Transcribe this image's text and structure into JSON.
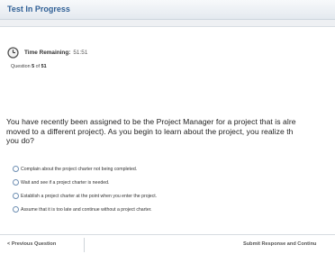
{
  "header": {
    "title": "Test In Progress"
  },
  "timer": {
    "label": "Time Remaining:",
    "value": "51:51",
    "icon": "clock-icon"
  },
  "progress": {
    "prefix": "Question",
    "current": "5",
    "of_label": "of",
    "total": "51"
  },
  "question": {
    "lines": [
      "You have recently been assigned to be the Project Manager for a project that is alre",
      "moved to a different project). As you begin to learn about the project, you realize th",
      "you do?"
    ]
  },
  "options": [
    "Complain about the project charter not being completed.",
    "Wait and see if a project charter is needed.",
    "Establish a project charter at the point when you enter the project.",
    "Assume that it is too late and continue without a project charter."
  ],
  "footer": {
    "previous_label": "< Previous Question",
    "submit_label": "Submit Response and Continu"
  },
  "colors": {
    "title_blue": "#2f5f95",
    "radio_border": "#6f8fb3"
  }
}
